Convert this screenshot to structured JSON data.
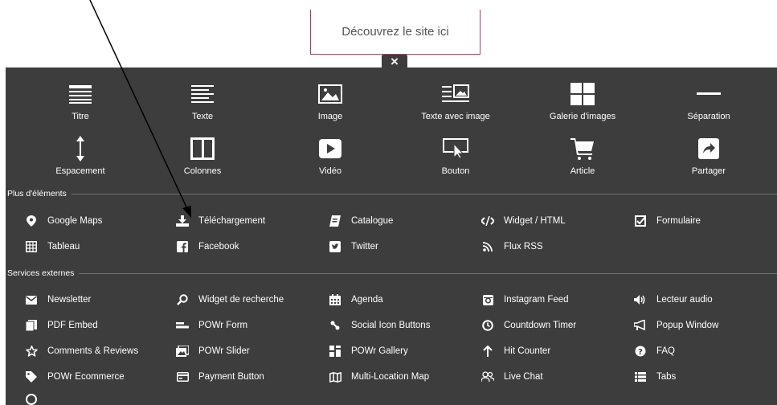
{
  "top": {
    "discover_label": "Découvrez le site ici",
    "close_glyph": "×"
  },
  "basic_elements": [
    {
      "label": "Titre",
      "icon": "title-icon"
    },
    {
      "label": "Texte",
      "icon": "text-icon"
    },
    {
      "label": "Image",
      "icon": "image-icon"
    },
    {
      "label": "Texte avec image",
      "icon": "text-with-image-icon"
    },
    {
      "label": "Galerie d'images",
      "icon": "gallery-icon"
    },
    {
      "label": "Séparation",
      "icon": "separator-icon"
    },
    {
      "label": "Espacement",
      "icon": "spacing-icon"
    },
    {
      "label": "Colonnes",
      "icon": "columns-icon"
    },
    {
      "label": "Vidéo",
      "icon": "video-icon"
    },
    {
      "label": "Bouton",
      "icon": "button-icon"
    },
    {
      "label": "Article",
      "icon": "cart-icon"
    },
    {
      "label": "Partager",
      "icon": "share-icon"
    }
  ],
  "more_section": {
    "title": "Plus d'éléments",
    "items": [
      {
        "label": "Google Maps",
        "icon": "map-pin-icon"
      },
      {
        "label": "Téléchargement",
        "icon": "download-icon"
      },
      {
        "label": "Catalogue",
        "icon": "catalog-icon"
      },
      {
        "label": "Widget / HTML",
        "icon": "code-icon"
      },
      {
        "label": "Formulaire",
        "icon": "form-checkbox-icon"
      },
      {
        "label": "Tableau",
        "icon": "table-icon"
      },
      {
        "label": "Facebook",
        "icon": "facebook-icon"
      },
      {
        "label": "Twitter",
        "icon": "twitter-icon"
      },
      {
        "label": "Flux RSS",
        "icon": "rss-icon"
      }
    ]
  },
  "external_section": {
    "title": "Services externes",
    "items": [
      {
        "label": "Newsletter",
        "icon": "envelope-icon"
      },
      {
        "label": "Widget de recherche",
        "icon": "search-icon"
      },
      {
        "label": "Agenda",
        "icon": "calendar-icon"
      },
      {
        "label": "Instagram Feed",
        "icon": "instagram-icon"
      },
      {
        "label": "Lecteur audio",
        "icon": "speaker-icon"
      },
      {
        "label": "PDF Embed",
        "icon": "pdf-icon"
      },
      {
        "label": "POWr Form",
        "icon": "form-bar-icon"
      },
      {
        "label": "Social Icon Buttons",
        "icon": "social-icon"
      },
      {
        "label": "Countdown Timer",
        "icon": "clock-icon"
      },
      {
        "label": "Popup Window",
        "icon": "megaphone-icon"
      },
      {
        "label": "Comments & Reviews",
        "icon": "star-icon"
      },
      {
        "label": "POWr Slider",
        "icon": "slider-icon"
      },
      {
        "label": "POWr Gallery",
        "icon": "gallery-small-icon"
      },
      {
        "label": "Hit Counter",
        "icon": "arrow-up-icon"
      },
      {
        "label": "FAQ",
        "icon": "question-icon"
      },
      {
        "label": "POWr Ecommerce",
        "icon": "tag-icon"
      },
      {
        "label": "Payment Button",
        "icon": "payment-icon"
      },
      {
        "label": "Multi-Location Map",
        "icon": "map-icon"
      },
      {
        "label": "Live Chat",
        "icon": "chat-icon"
      },
      {
        "label": "Tabs",
        "icon": "tabs-icon"
      }
    ]
  }
}
